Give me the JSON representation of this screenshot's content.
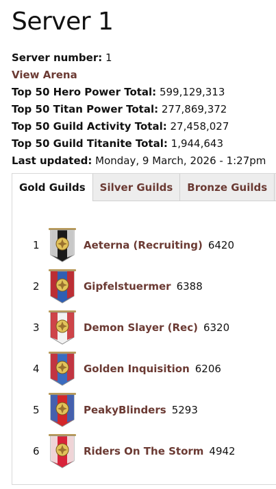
{
  "page": {
    "title": "Server 1"
  },
  "stats": {
    "server_number_label": "Server number:",
    "server_number_value": "1",
    "view_arena": "View Arena",
    "hero_power_label": "Top 50 Hero Power Total:",
    "hero_power_value": "599,129,313",
    "titan_power_label": "Top 50 Titan Power Total:",
    "titan_power_value": "277,869,372",
    "guild_activity_label": "Top 50 Guild Activity Total:",
    "guild_activity_value": "27,458,027",
    "guild_titanite_label": "Top 50 Guild Titanite Total:",
    "guild_titanite_value": "1,944,643",
    "last_updated_label": "Last updated:",
    "last_updated_value": "Monday, 9 March, 2026 - 1:27pm"
  },
  "tabs": [
    {
      "label": "Gold Guilds",
      "active": true
    },
    {
      "label": "Silver Guilds",
      "active": false
    },
    {
      "label": "Bronze Guilds",
      "active": false
    }
  ],
  "guilds": [
    {
      "rank": "1",
      "name": "Aeterna (Recruiting)",
      "score": "6420",
      "banner": "dark-flag-gold-emblem-icon",
      "colors": [
        "#1a1a1a",
        "#e8e8e8"
      ]
    },
    {
      "rank": "2",
      "name": "Gipfelstuermer",
      "score": "6388",
      "banner": "blue-flag-fleur-de-lis-icon",
      "colors": [
        "#2f5fb3",
        "#d4261f"
      ]
    },
    {
      "rank": "3",
      "name": "Demon Slayer (Rec)",
      "score": "6320",
      "banner": "white-flag-crossed-swords-icon",
      "colors": [
        "#f2f2f2",
        "#c8262b"
      ]
    },
    {
      "rank": "4",
      "name": "Golden Inquisition",
      "score": "6206",
      "banner": "blue-red-flag-cross-icon",
      "colors": [
        "#3a6cc0",
        "#d92b2b"
      ]
    },
    {
      "rank": "5",
      "name": "PeakyBlinders",
      "score": "5293",
      "banner": "red-blue-flag-eagle-icon",
      "colors": [
        "#d3272a",
        "#2d6bc4"
      ]
    },
    {
      "rank": "6",
      "name": "Riders On The Storm",
      "score": "4942",
      "banner": "red-flag-white-beast-icon",
      "colors": [
        "#d8233a",
        "#f3f3f3"
      ]
    }
  ]
}
